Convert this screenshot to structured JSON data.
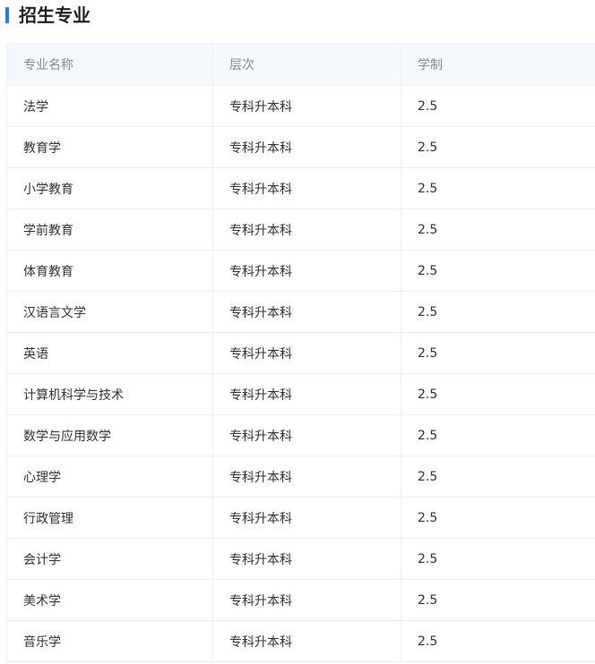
{
  "section": {
    "title": "招生专业"
  },
  "colors": {
    "accent": "#1e7ef0",
    "header_bg": "#f5f8fd",
    "border": "#eceff4"
  },
  "table": {
    "headers": [
      "专业名称",
      "层次",
      "学制"
    ],
    "rows": [
      {
        "name": "法学",
        "level": "专科升本科",
        "duration": "2.5"
      },
      {
        "name": "教育学",
        "level": "专科升本科",
        "duration": "2.5"
      },
      {
        "name": "小学教育",
        "level": "专科升本科",
        "duration": "2.5"
      },
      {
        "name": "学前教育",
        "level": "专科升本科",
        "duration": "2.5"
      },
      {
        "name": "体育教育",
        "level": "专科升本科",
        "duration": "2.5"
      },
      {
        "name": "汉语言文学",
        "level": "专科升本科",
        "duration": "2.5"
      },
      {
        "name": "英语",
        "level": "专科升本科",
        "duration": "2.5"
      },
      {
        "name": "计算机科学与技术",
        "level": "专科升本科",
        "duration": "2.5"
      },
      {
        "name": "数学与应用数学",
        "level": "专科升本科",
        "duration": "2.5"
      },
      {
        "name": "心理学",
        "level": "专科升本科",
        "duration": "2.5"
      },
      {
        "name": "行政管理",
        "level": "专科升本科",
        "duration": "2.5"
      },
      {
        "name": "会计学",
        "level": "专科升本科",
        "duration": "2.5"
      },
      {
        "name": "美术学",
        "level": "专科升本科",
        "duration": "2.5"
      },
      {
        "name": "音乐学",
        "level": "专科升本科",
        "duration": "2.5"
      }
    ]
  }
}
